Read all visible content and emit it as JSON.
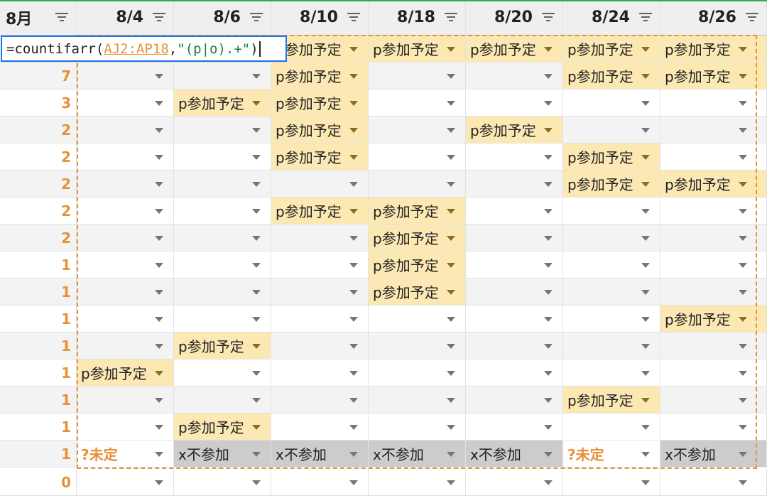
{
  "sheet": {
    "headers": [
      "8月",
      "8/4",
      "8/6",
      "8/10",
      "8/18",
      "8/20",
      "8/24",
      "8/26"
    ],
    "formula": {
      "prefix": "=countifarr(",
      "range": "AJ2:AP18",
      "comma": ",",
      "pattern": "\"(p|o).+\"",
      "suffix": ")"
    },
    "value_labels": {
      "p": "p参加予定",
      "x": "x不参加",
      "q": "?未定"
    },
    "rows": [
      {
        "count": "",
        "cells": [
          "",
          "",
          "p",
          "p",
          "p",
          "p",
          "p"
        ]
      },
      {
        "count": "7",
        "cells": [
          "",
          "",
          "p",
          "",
          "",
          "p",
          "p"
        ]
      },
      {
        "count": "3",
        "cells": [
          "",
          "p",
          "p",
          "",
          "",
          "",
          ""
        ]
      },
      {
        "count": "2",
        "cells": [
          "",
          "",
          "p",
          "",
          "p",
          "",
          ""
        ]
      },
      {
        "count": "2",
        "cells": [
          "",
          "",
          "p",
          "",
          "",
          "p",
          ""
        ]
      },
      {
        "count": "2",
        "cells": [
          "",
          "",
          "",
          "",
          "",
          "p",
          "p"
        ]
      },
      {
        "count": "2",
        "cells": [
          "",
          "",
          "p",
          "p",
          "",
          "",
          ""
        ]
      },
      {
        "count": "2",
        "cells": [
          "",
          "",
          "",
          "p",
          "",
          "",
          ""
        ]
      },
      {
        "count": "1",
        "cells": [
          "",
          "",
          "",
          "p",
          "",
          "",
          ""
        ]
      },
      {
        "count": "1",
        "cells": [
          "",
          "",
          "",
          "p",
          "",
          "",
          ""
        ]
      },
      {
        "count": "1",
        "cells": [
          "",
          "",
          "",
          "",
          "",
          "",
          "p"
        ]
      },
      {
        "count": "1",
        "cells": [
          "",
          "p",
          "",
          "",
          "",
          "",
          ""
        ]
      },
      {
        "count": "1",
        "cells": [
          "p",
          "",
          "",
          "",
          "",
          "",
          ""
        ]
      },
      {
        "count": "1",
        "cells": [
          "",
          "",
          "",
          "",
          "",
          "p",
          ""
        ]
      },
      {
        "count": "1",
        "cells": [
          "",
          "p",
          "",
          "",
          "",
          "",
          ""
        ]
      },
      {
        "count": "1",
        "cells": [
          "q",
          "x",
          "x",
          "x",
          "x",
          "q",
          "x"
        ]
      },
      {
        "count": "0",
        "cells": [
          "",
          "",
          "",
          "",
          "",
          "",
          ""
        ]
      }
    ],
    "colors": {
      "participating_bg": "#fce8b2",
      "absent_bg": "#cccccc",
      "count_text": "#e69138",
      "selection_border": "#e69138",
      "formula_border": "#1a73e8"
    }
  }
}
